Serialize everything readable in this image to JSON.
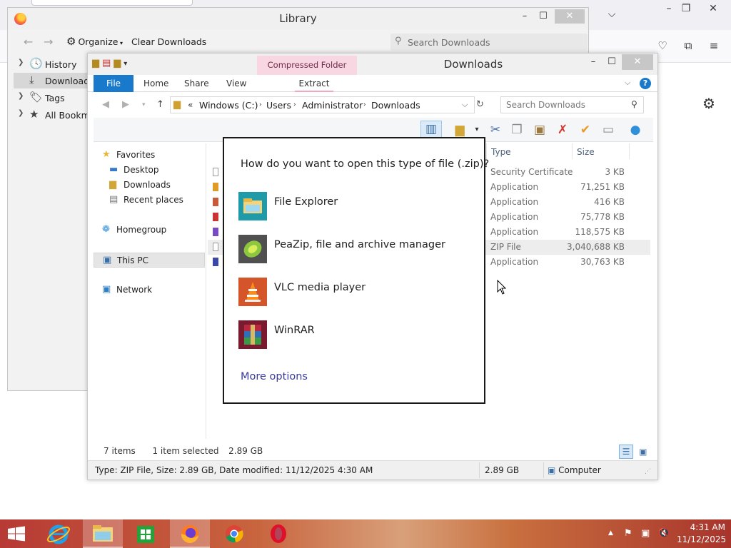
{
  "library": {
    "title": "Library",
    "toolbar": {
      "organize_label": "Organize",
      "clear_downloads_label": "Clear Downloads",
      "search_placeholder": "Search Downloads"
    },
    "sidebar": [
      {
        "label": "History",
        "icon": "clock-icon"
      },
      {
        "label": "Downloads",
        "icon": "download-icon",
        "selected": true
      },
      {
        "label": "Tags",
        "icon": "tag-icon"
      },
      {
        "label": "All Bookmarks",
        "icon": "star-icon"
      }
    ]
  },
  "explorer": {
    "title": "Downloads",
    "context_tab": "Compressed Folder Tools",
    "ribbon_tabs": [
      "File",
      "Home",
      "Share",
      "View"
    ],
    "extract_tab": "Extract",
    "address": {
      "prefix": "«",
      "crumbs": [
        "Windows (C:)",
        "Users",
        "Administrator",
        "Downloads"
      ]
    },
    "search_placeholder": "Search Downloads",
    "nav": [
      {
        "label": "Favorites",
        "icon": "star-icon"
      },
      {
        "label": "Desktop",
        "icon": "desktop-icon"
      },
      {
        "label": "Downloads",
        "icon": "folder-icon"
      },
      {
        "label": "Recent places",
        "icon": "recent-places-icon"
      },
      {
        "label": "Homegroup",
        "icon": "homegroup-icon"
      },
      {
        "label": "This PC",
        "icon": "computer-icon",
        "selected": true
      },
      {
        "label": "Network",
        "icon": "network-icon"
      }
    ],
    "columns": {
      "type": "Type",
      "size": "Size"
    },
    "rows": [
      {
        "type": "Security Certificate",
        "size": "3 KB"
      },
      {
        "type": "Application",
        "size": "71,251 KB"
      },
      {
        "type": "Application",
        "size": "416 KB"
      },
      {
        "type": "Application",
        "size": "75,778 KB"
      },
      {
        "type": "Application",
        "size": "118,575 KB"
      },
      {
        "type": "ZIP File",
        "size": "3,040,688 KB",
        "selected": true
      },
      {
        "type": "Application",
        "size": "30,763 KB"
      }
    ],
    "status": {
      "items_count": "7 items",
      "selected": "1 item selected",
      "selected_size": "2.89 GB"
    },
    "statusbar": {
      "details": "Type: ZIP File, Size: 2.89 GB, Date modified: 11/12/2025 4:30 AM",
      "size": "2.89 GB",
      "location": "Computer"
    }
  },
  "open_with": {
    "question": "How do you want to open this type of file (.zip)?",
    "apps": [
      {
        "label": "File Explorer",
        "icon": "file-explorer-icon"
      },
      {
        "label": "PeaZip, file and archive manager",
        "icon": "peazip-icon"
      },
      {
        "label": "VLC media player",
        "icon": "vlc-icon"
      },
      {
        "label": "WinRAR",
        "icon": "winrar-icon"
      }
    ],
    "more_options": "More options"
  },
  "taskbar": {
    "apps": [
      "internet-explorer-icon",
      "file-explorer-icon",
      "store-icon",
      "firefox-icon",
      "chrome-icon",
      "opera-icon"
    ],
    "clock_time": "4:31 AM",
    "clock_date": "11/12/2025"
  },
  "colors": {
    "accent": "#1979ca",
    "context_tab": "#f9d7e2",
    "link": "#3b3b9e"
  }
}
